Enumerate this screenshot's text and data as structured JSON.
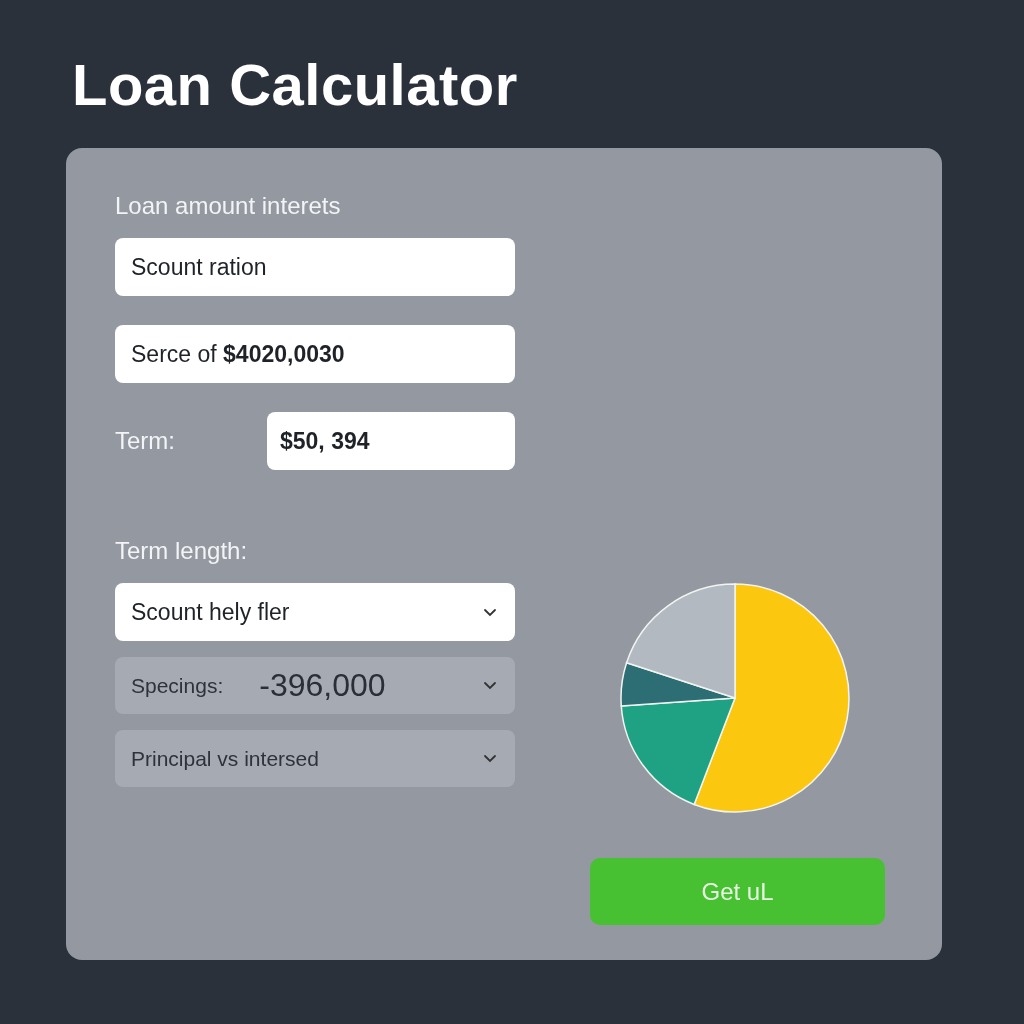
{
  "title": "Loan Calculator",
  "form": {
    "fields": [
      {
        "kind": "label",
        "text": "Loan amount interets"
      },
      {
        "kind": "input",
        "value": "Scount ration"
      },
      {
        "kind": "input",
        "value": "Serce of **$4020,0030**"
      },
      {
        "kind": "labeled_input",
        "label": "Term:",
        "value": "$50, 394"
      },
      {
        "kind": "label",
        "text": "Term length:"
      },
      {
        "kind": "select",
        "value": "Scount hely fler",
        "disabled": false
      },
      {
        "kind": "select",
        "label": "Specings:",
        "value": "-396,000",
        "disabled": true
      },
      {
        "kind": "select",
        "value": "Principal vs intersed",
        "disabled": true
      }
    ],
    "button": "Get uL"
  }
}
